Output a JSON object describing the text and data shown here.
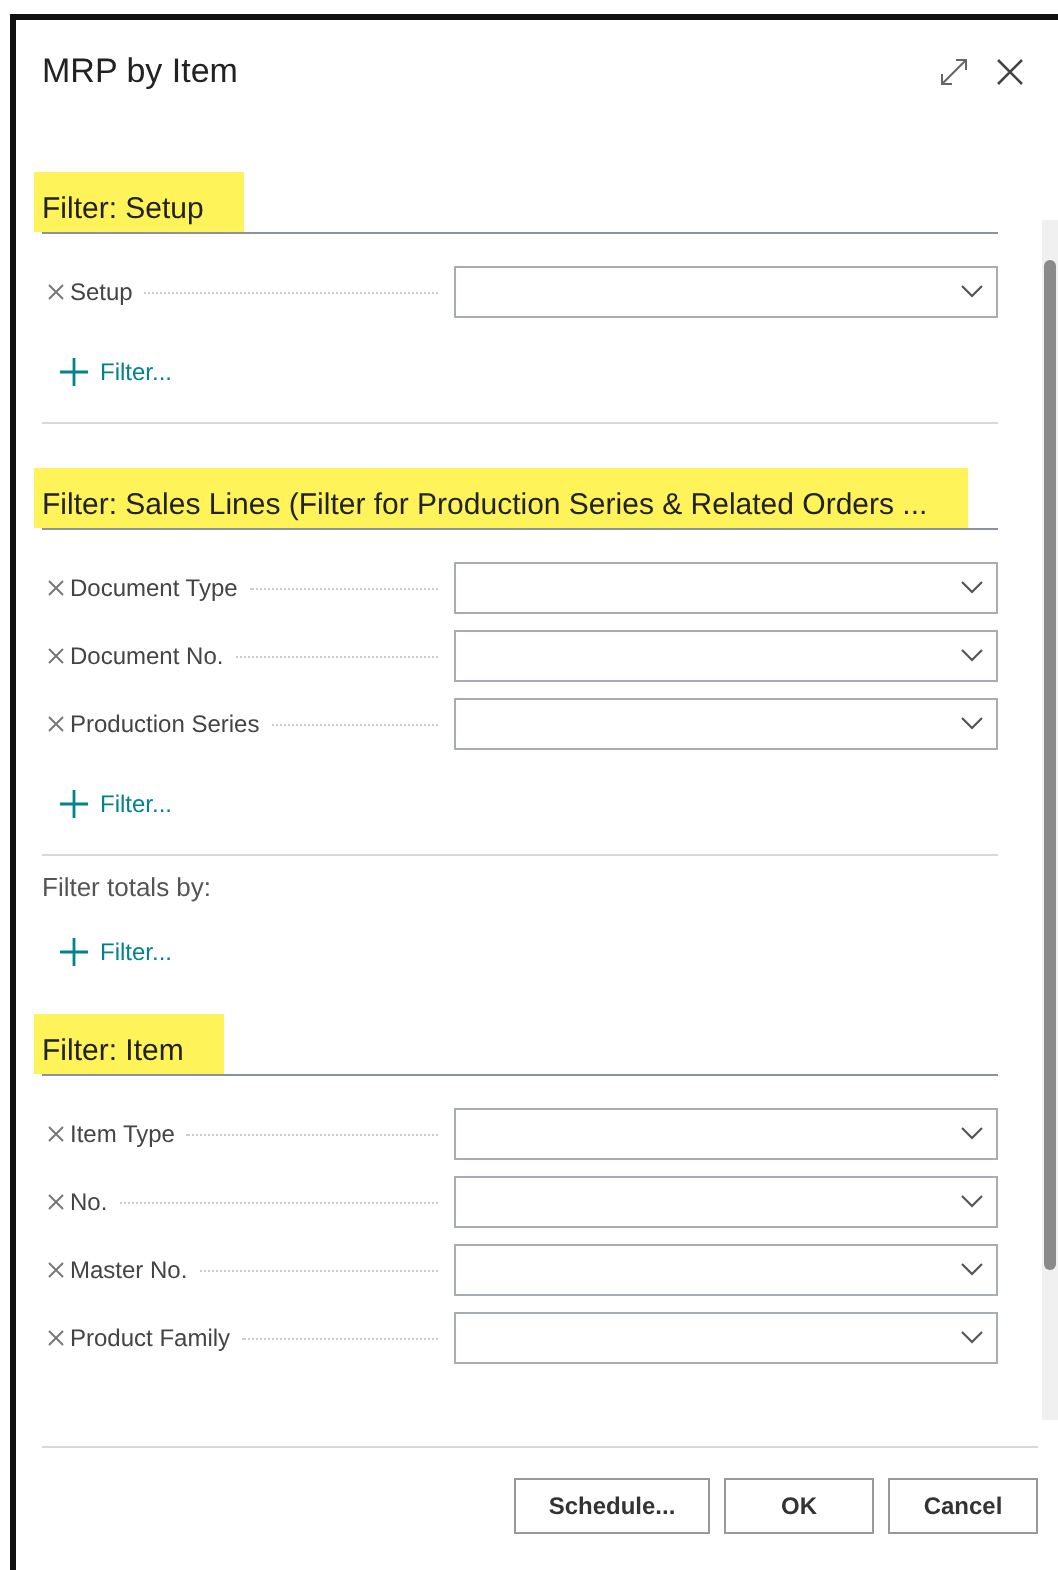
{
  "dialog": {
    "title": "MRP by Item"
  },
  "sections": [
    {
      "kind": "filter_group",
      "title": "Filter: Setup",
      "highlighted": true,
      "fields": [
        {
          "label": "Setup"
        }
      ],
      "add_filter": "Filter..."
    },
    {
      "kind": "filter_group",
      "title": "Filter: Sales Lines (Filter for Production Series & Related Orders ...",
      "highlighted": true,
      "fields": [
        {
          "label": "Document Type"
        },
        {
          "label": "Document No."
        },
        {
          "label": "Production Series"
        }
      ],
      "add_filter": "Filter..."
    },
    {
      "kind": "totals",
      "label": "Filter totals by:",
      "add_filter": "Filter..."
    },
    {
      "kind": "filter_group",
      "title": "Filter: Item",
      "highlighted": true,
      "fields": [
        {
          "label": "Item Type"
        },
        {
          "label": "No."
        },
        {
          "label": "Master No."
        },
        {
          "label": "Product Family"
        }
      ]
    }
  ],
  "buttons": [
    "Schedule...",
    "OK",
    "Cancel"
  ]
}
